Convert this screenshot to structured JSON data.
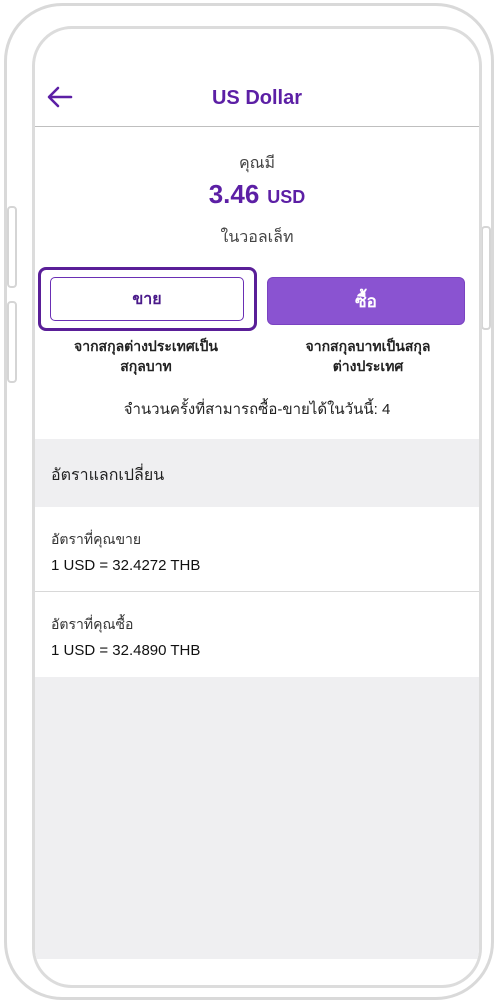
{
  "header": {
    "title": "US Dollar",
    "back_icon": "arrow-left-icon"
  },
  "balance": {
    "label": "คุณมี",
    "amount": "3.46",
    "currency": "USD",
    "location": "ในวอลเล็ท"
  },
  "actions": {
    "sell_label": "ขาย",
    "sell_desc_line1": "จากสกุลต่างประเทศเป็น",
    "sell_desc_line2": "สกุลบาท",
    "buy_label": "ซื้อ",
    "buy_desc_line1": "จากสกุลบาทเป็นสกุล",
    "buy_desc_line2": "ต่างประเทศ"
  },
  "limit": {
    "text": "จำนวนครั้งที่สามารถซื้อ-ขายได้ในวันนี้: 4"
  },
  "rates": {
    "section_title": "อัตราแลกเปลี่ยน",
    "items": [
      {
        "label": "อัตราที่คุณขาย",
        "value": "1 USD = 32.4272 THB"
      },
      {
        "label": "อัตราที่คุณซื้อ",
        "value": "1 USD = 32.4890 THB"
      }
    ]
  },
  "colors": {
    "accent": "#5c1fa5",
    "buy_button": "#8a53d1",
    "section_bg": "#efeff1"
  }
}
